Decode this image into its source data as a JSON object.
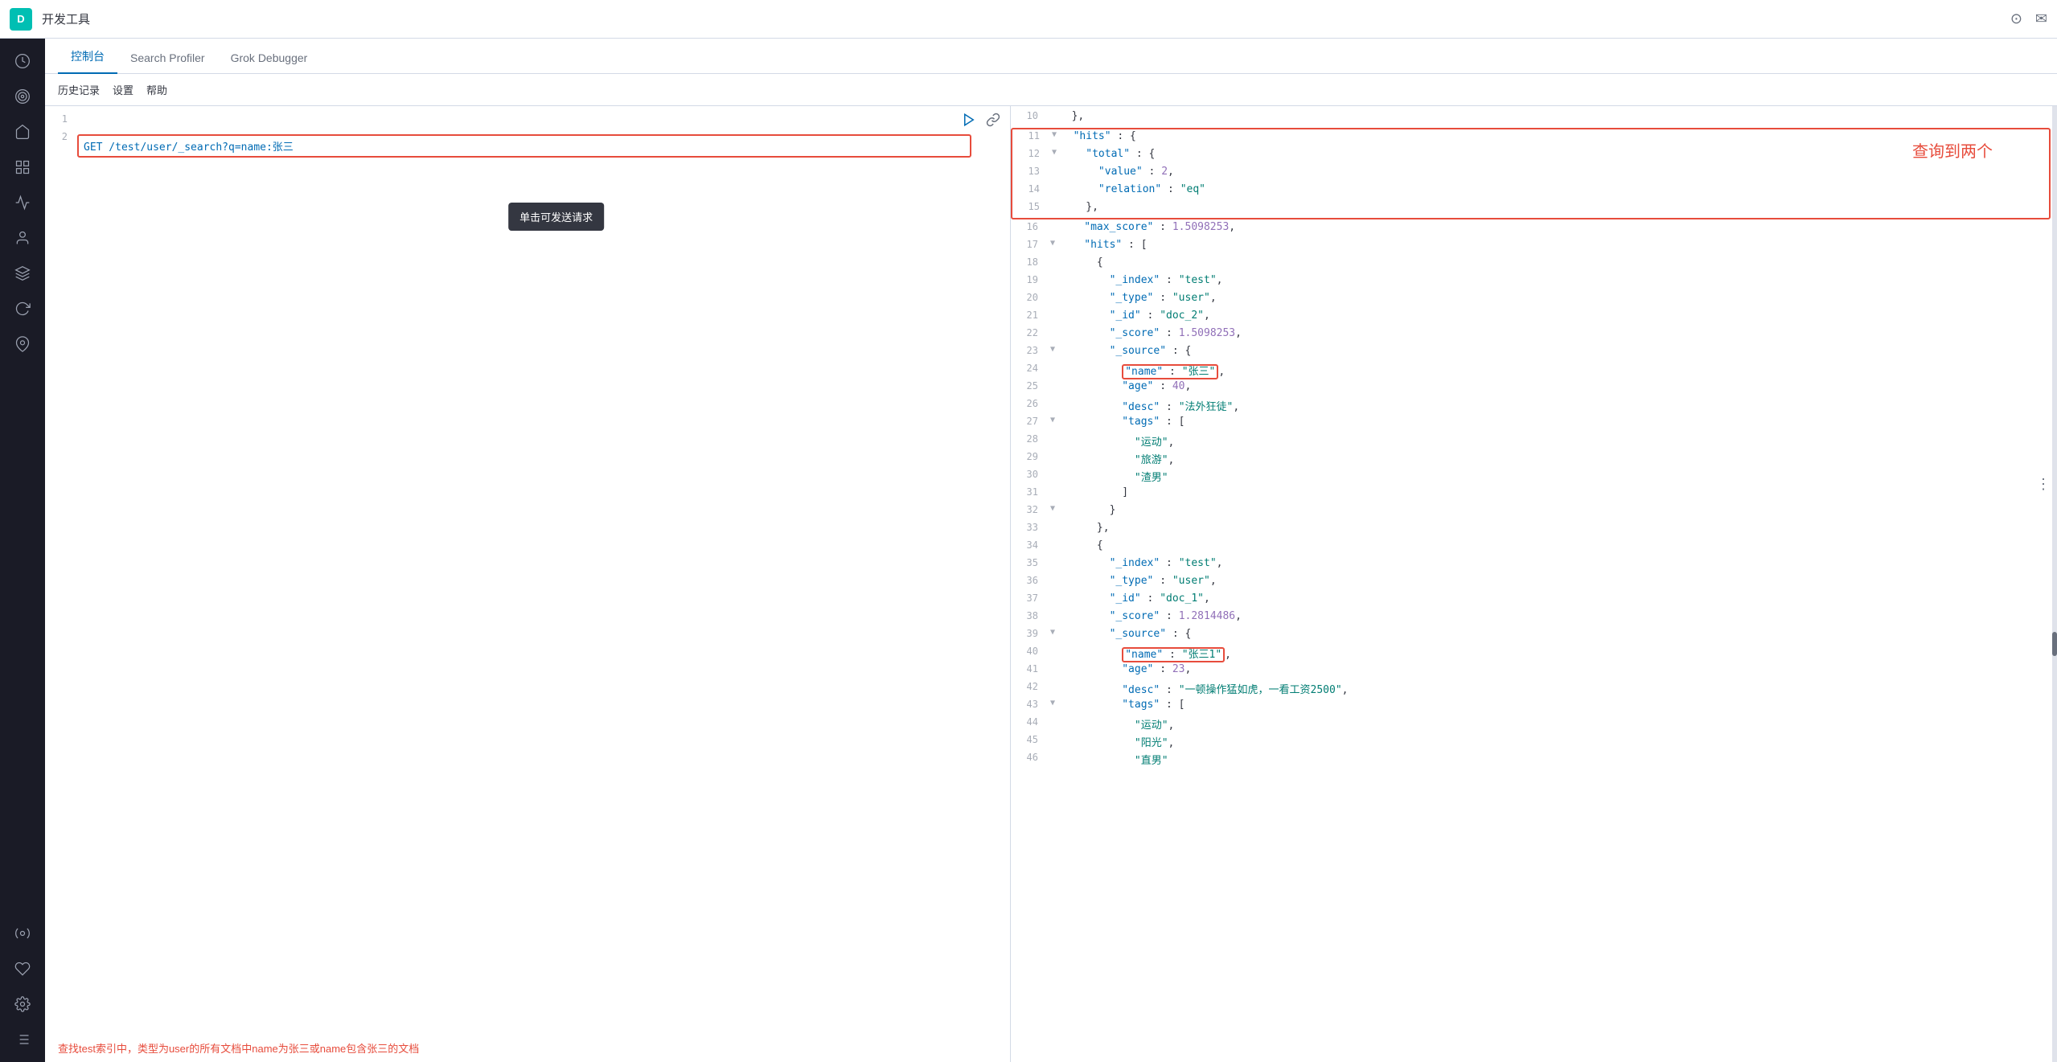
{
  "header": {
    "logo_letter": "D",
    "app_title": "开发工具",
    "icon_settings": "⊙",
    "icon_mail": "✉"
  },
  "sidebar": {
    "items": [
      {
        "id": "clock",
        "icon": "🕐",
        "label": "clock-icon",
        "active": false
      },
      {
        "id": "target",
        "icon": "◎",
        "label": "target-icon",
        "active": false
      },
      {
        "id": "home",
        "icon": "⌂",
        "label": "home-icon",
        "active": false
      },
      {
        "id": "grid",
        "icon": "⊞",
        "label": "grid-icon",
        "active": false
      },
      {
        "id": "chart",
        "icon": "📊",
        "label": "chart-icon",
        "active": false
      },
      {
        "id": "person",
        "icon": "👤",
        "label": "person-icon",
        "active": false
      },
      {
        "id": "layers",
        "icon": "◫",
        "label": "layers-icon",
        "active": false
      },
      {
        "id": "refresh",
        "icon": "↻",
        "label": "refresh-icon",
        "active": false
      },
      {
        "id": "pin",
        "icon": "📌",
        "label": "pin-icon",
        "active": false
      },
      {
        "id": "tools",
        "icon": "⚙",
        "label": "tools-icon",
        "active": false
      },
      {
        "id": "heart",
        "icon": "♡",
        "label": "heart-icon",
        "active": false
      },
      {
        "id": "settings",
        "icon": "⚙",
        "label": "settings-icon",
        "active": false
      },
      {
        "id": "list",
        "icon": "☰",
        "label": "list-icon",
        "active": false
      }
    ]
  },
  "tabs": [
    {
      "id": "console",
      "label": "控制台",
      "active": true
    },
    {
      "id": "search-profiler",
      "label": "Search Profiler",
      "active": false
    },
    {
      "id": "grok-debugger",
      "label": "Grok Debugger",
      "active": false
    }
  ],
  "toolbar": {
    "items": [
      {
        "id": "history",
        "label": "历史记录"
      },
      {
        "id": "settings",
        "label": "设置"
      },
      {
        "id": "help",
        "label": "帮助"
      }
    ]
  },
  "tooltip": {
    "text": "单击可发送请求"
  },
  "editor": {
    "line1": "",
    "line2_query": "GET /test/user/_search?q=name:张三"
  },
  "description": {
    "text": "查找test索引中，类型为user的所有文档中name为张三或name包含张三的文档"
  },
  "annotation": {
    "text": "查询到两个"
  },
  "json_output": {
    "lines": [
      {
        "num": 10,
        "indent": "  ",
        "content": "},",
        "type": "punct"
      },
      {
        "num": 11,
        "indent": "  ",
        "key": "hits",
        "punct_open": " : {",
        "highlight": true
      },
      {
        "num": 12,
        "indent": "    ",
        "key": "total",
        "punct_open": " : {"
      },
      {
        "num": 13,
        "indent": "      ",
        "key": "value",
        "value": "2",
        "value_type": "number",
        "highlight": true
      },
      {
        "num": 14,
        "indent": "      ",
        "key": "relation",
        "value": "\"eq\"",
        "value_type": "string"
      },
      {
        "num": 15,
        "indent": "    ",
        "content": "},",
        "highlight": true
      },
      {
        "num": 16,
        "indent": "    ",
        "key": "max_score",
        "value": "1.5098253,"
      },
      {
        "num": 17,
        "indent": "    ",
        "key": "hits",
        "value": "[",
        "collapse": "▼"
      },
      {
        "num": 18,
        "indent": "      ",
        "content": "{"
      },
      {
        "num": 19,
        "indent": "        ",
        "key": "_index",
        "value": "\"test\","
      },
      {
        "num": 20,
        "indent": "        ",
        "key": "_type",
        "value": "\"user\","
      },
      {
        "num": 21,
        "indent": "        ",
        "key": "_id",
        "value": "\"doc_2\","
      },
      {
        "num": 22,
        "indent": "        ",
        "key": "_score",
        "value": "1.5098253,"
      },
      {
        "num": 23,
        "indent": "        ",
        "key": "_source",
        "value": " : {",
        "collapse": "▼"
      },
      {
        "num": 24,
        "indent": "          ",
        "key": "name",
        "value": "\"张三\"",
        "highlight": true
      },
      {
        "num": 25,
        "indent": "          ",
        "key": "age",
        "value": "40,"
      },
      {
        "num": 26,
        "indent": "          ",
        "key": "desc",
        "value": "\"法外狂徒\","
      },
      {
        "num": 27,
        "indent": "          ",
        "key": "tags",
        "value": "[",
        "collapse": "▼"
      },
      {
        "num": 28,
        "indent": "            ",
        "value": "\"运动\","
      },
      {
        "num": 29,
        "indent": "            ",
        "value": "\"旅游\","
      },
      {
        "num": 30,
        "indent": "            ",
        "value": "\"渣男\""
      },
      {
        "num": 31,
        "indent": "          ",
        "content": "]"
      },
      {
        "num": 32,
        "indent": "        ",
        "content": "}",
        "collapse": "▼"
      },
      {
        "num": 33,
        "indent": "      ",
        "content": "},"
      },
      {
        "num": 34,
        "indent": "      ",
        "content": "{"
      },
      {
        "num": 35,
        "indent": "        ",
        "key": "_index",
        "value": "\"test\","
      },
      {
        "num": 36,
        "indent": "        ",
        "key": "_type",
        "value": "\"user\","
      },
      {
        "num": 37,
        "indent": "        ",
        "key": "_id",
        "value": "\"doc_1\","
      },
      {
        "num": 38,
        "indent": "        ",
        "key": "_score",
        "value": "1.2814486,"
      },
      {
        "num": 39,
        "indent": "        ",
        "key": "_source",
        "value": " : {",
        "collapse": "▼"
      },
      {
        "num": 40,
        "indent": "          ",
        "key": "name",
        "value": "\"张三1\"",
        "highlight": true
      },
      {
        "num": 41,
        "indent": "          ",
        "key": "age",
        "value": "23,"
      },
      {
        "num": 42,
        "indent": "          ",
        "key": "desc",
        "value": "\"一顿操作猛如虎，一看工资2500\","
      },
      {
        "num": 43,
        "indent": "          ",
        "key": "tags",
        "value": "[",
        "collapse": "▼"
      },
      {
        "num": 44,
        "indent": "            ",
        "value": "\"运动\","
      },
      {
        "num": 45,
        "indent": "            ",
        "value": "\"阳光\","
      },
      {
        "num": 46,
        "indent": "            ",
        "value": "\"直男\""
      }
    ]
  }
}
